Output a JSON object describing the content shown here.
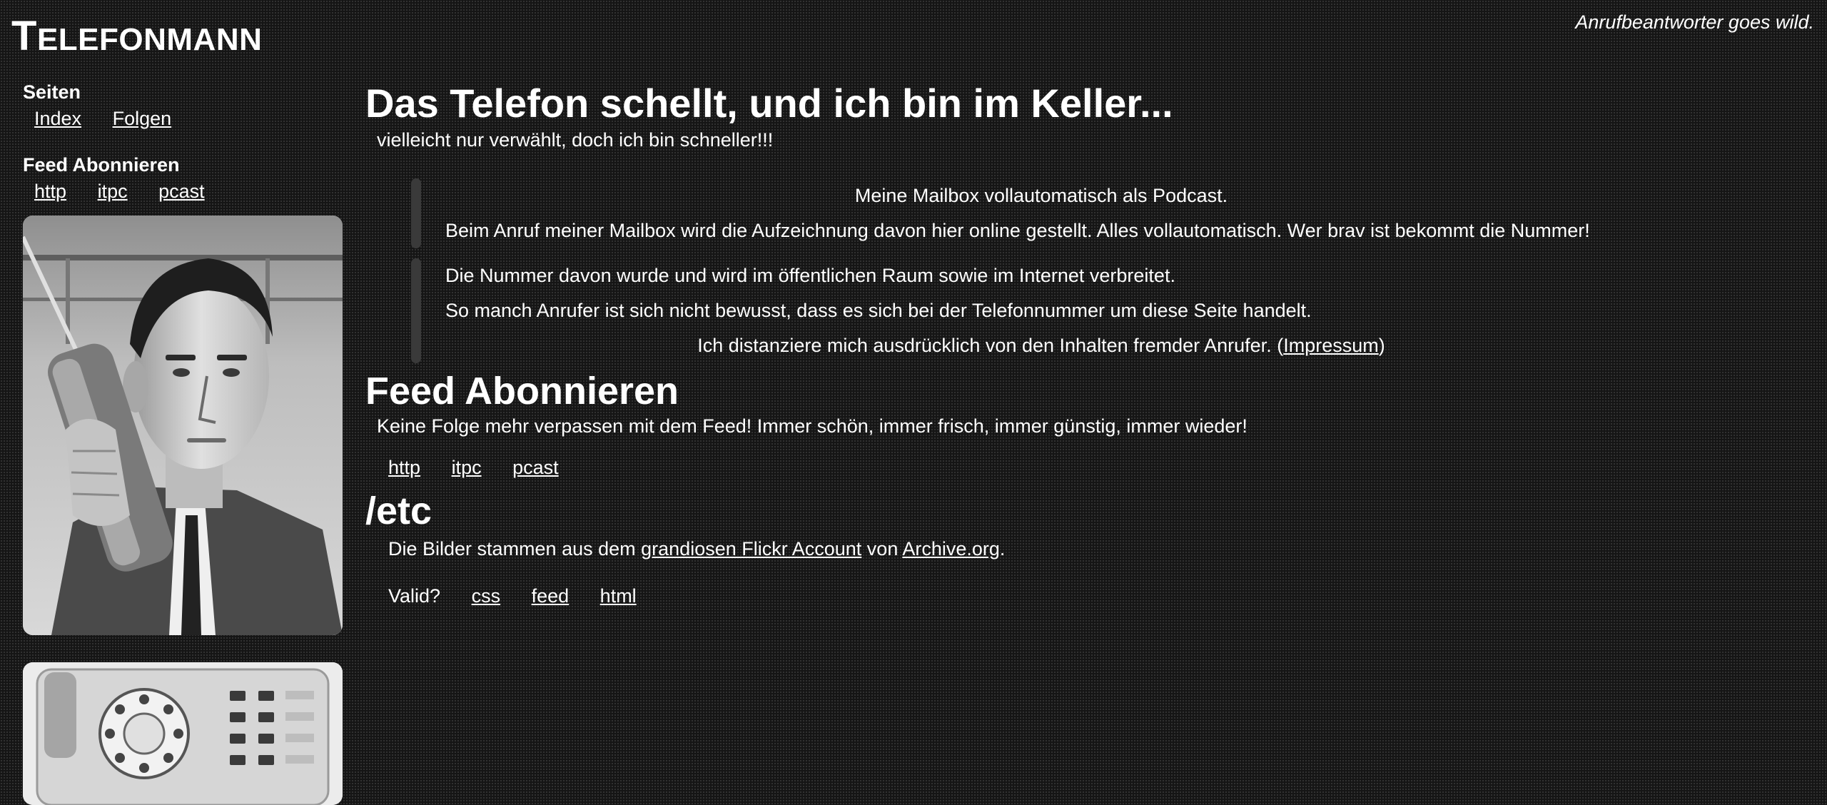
{
  "header": {
    "title_first": "T",
    "title_rest": "ELEFONMANN",
    "tagline": "Anrufbeantworter goes wild."
  },
  "sidebar": {
    "pages_heading": "Seiten",
    "pages_links": [
      "Index",
      "Folgen"
    ],
    "feed_heading": "Feed Abonnieren",
    "feed_links": [
      "http",
      "itpc",
      "pcast"
    ],
    "images": [
      "man-on-phone-photo",
      "telephone-photo"
    ]
  },
  "main": {
    "title": "Das Telefon schellt, und ich bin im Keller...",
    "subtitle": "vielleicht nur verwählt, doch ich bin schneller!!!",
    "quote1": {
      "line1": "Meine Mailbox vollautomatisch als Podcast.",
      "line2": "Beim Anruf meiner Mailbox wird die Aufzeichnung davon hier online gestellt. Alles vollautomatisch. Wer brav ist bekommt die Nummer!"
    },
    "quote2": {
      "line1": "Die Nummer davon wurde und wird im öffentlichen Raum sowie im Internet verbreitet.",
      "line2": "So manch Anrufer ist sich nicht bewusst, dass es sich bei der Telefonnummer um diese Seite handelt.",
      "line3_before": "Ich distanziere mich ausdrücklich von den Inhalten fremder Anrufer. (",
      "line3_link": "Impressum",
      "line3_after": ")"
    },
    "feed": {
      "heading": "Feed Abonnieren",
      "text": "Keine Folge mehr verpassen mit dem Feed! Immer schön, immer frisch, immer günstig, immer wieder!",
      "links": [
        "http",
        "itpc",
        "pcast"
      ]
    },
    "etc": {
      "heading": "/etc",
      "credits_before": "Die Bilder stammen aus dem ",
      "credits_link1": "grandiosen Flickr Account",
      "credits_mid": " von ",
      "credits_link2": "Archive.org",
      "credits_after": ".",
      "valid_label": "Valid?",
      "valid_links": [
        "css",
        "feed",
        "html"
      ]
    }
  }
}
